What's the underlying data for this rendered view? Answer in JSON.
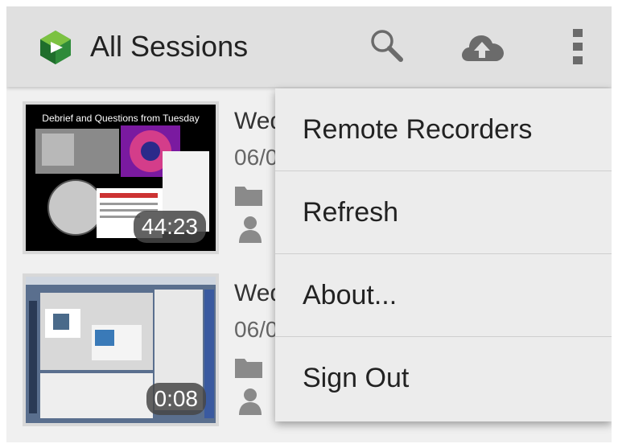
{
  "appbar": {
    "title": "All Sessions",
    "icons": {
      "logo": "panopto-logo-icon",
      "search": "search-icon",
      "upload": "cloud-upload-icon",
      "overflow": "overflow-menu-icon"
    }
  },
  "sessions": [
    {
      "title": "Wed",
      "date": "06/0",
      "duration": "44:23",
      "thumbnail_text": "Debrief and Questions from Tuesday"
    },
    {
      "title": "Wed",
      "date": "06/0",
      "duration": "0:08"
    }
  ],
  "menu": {
    "items": [
      {
        "label": "Remote Recorders"
      },
      {
        "label": "Refresh"
      },
      {
        "label": "About..."
      },
      {
        "label": "Sign Out"
      }
    ]
  },
  "colors": {
    "appbar_bg": "#e0e0e0",
    "background": "#f0f0f0",
    "menu_bg": "#ececec",
    "logo_green_dark": "#2e8b3a",
    "logo_green_light": "#7cc242",
    "icon_gray": "#6b6b6b"
  }
}
